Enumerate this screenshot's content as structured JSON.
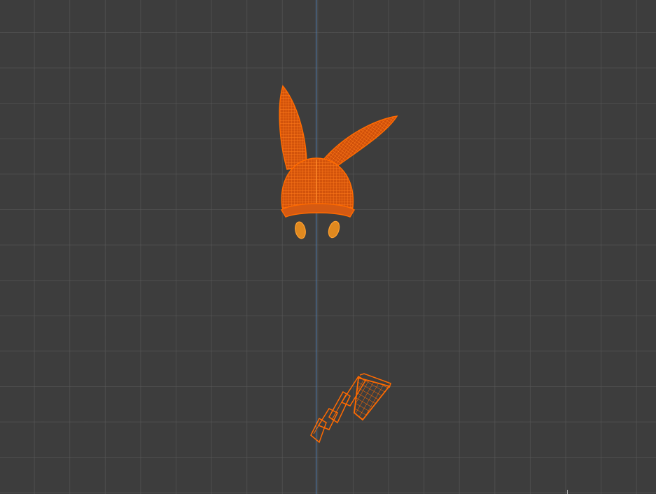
{
  "viewport": {
    "background_color": "#3d3d3d",
    "grid_color": "#5a5a5a",
    "axis_color": "#4f7eb3",
    "selection_color": "#ff6a00",
    "selection_light_color": "#ffa030"
  },
  "objects": [
    {
      "name": "bunny-hat",
      "kind": "wireframe mesh",
      "selected": true
    },
    {
      "name": "eye-left",
      "kind": "wireframe mesh",
      "selected": true
    },
    {
      "name": "eye-right",
      "kind": "wireframe mesh",
      "selected": true
    },
    {
      "name": "net-wand",
      "kind": "wireframe mesh",
      "selected": true
    }
  ]
}
